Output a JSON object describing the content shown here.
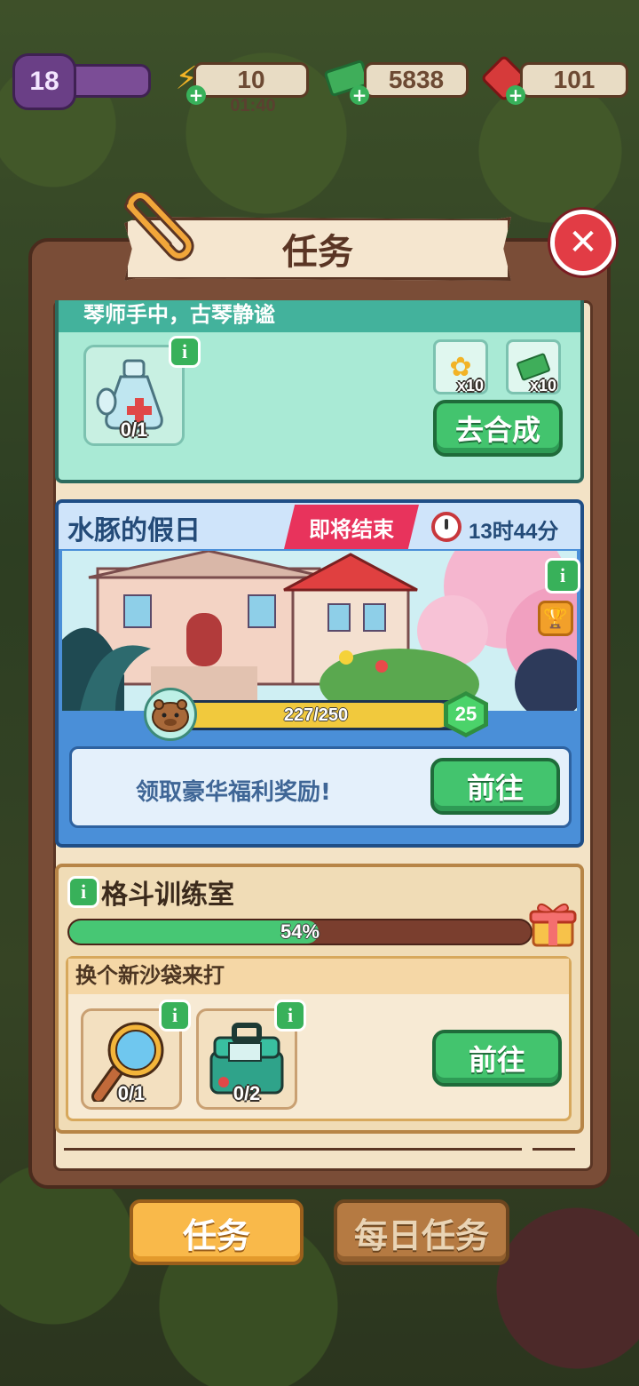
{
  "hud": {
    "level": "18",
    "energy": "10",
    "energy_timer": "01:40",
    "cash": "5838",
    "gems": "101"
  },
  "panel": {
    "title": "任务"
  },
  "craft_task": {
    "description": "琴师手中，古琴静谧",
    "item_progress": "0/1",
    "reward_1_qty": "x10",
    "reward_2_qty": "x10",
    "button_label": "去合成"
  },
  "event": {
    "title": "水豚的假日",
    "ending_badge": "即将结束",
    "time_left": "13时44分",
    "progress_text": "227/250",
    "progress_fraction": 0.908,
    "level": "25",
    "reward_text": "领取豪华福利奖励!",
    "button_label": "前往"
  },
  "room": {
    "title": "格斗训练室",
    "progress_text": "54%",
    "progress_fraction": 0.54,
    "task_title": "换个新沙袋来打",
    "item_1_progress": "0/1",
    "item_2_progress": "0/2",
    "button_label": "前往"
  },
  "tabs": {
    "tasks": "任务",
    "daily": "每日任务"
  },
  "colors": {
    "accent_green": "#43c46e",
    "event_blue": "#4a8fd8",
    "ending_red": "#e8335c",
    "tab_active": "#f9b94a"
  }
}
